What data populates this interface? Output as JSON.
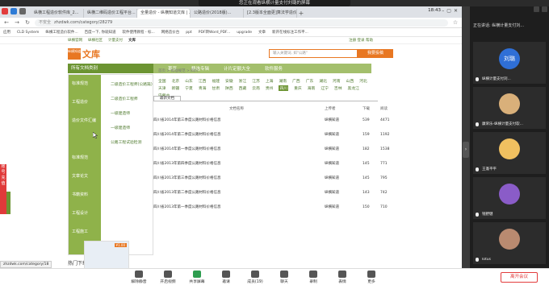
{
  "banner": "您正在观看纵横计量支付刘璐的屏幕",
  "browser": {
    "tabs": [
      "纵横工程造价软件库_2...",
      "纵横二维码造价工程平台...",
      "全量造价 - 纵横知道文库 | ...",
      "公路造价(2018版)...",
      "[2.3版本全面更]算法学造价..."
    ],
    "clock": "18:43",
    "unsafe_label": "不安全",
    "url": "zhzdwk.com/category/28279",
    "bookmarks": [
      "应用",
      "CLD System",
      "纵横工程造价软件...",
      "百度一下, 你就知道",
      "软件使用教程 - 标...",
      "网络造价台",
      "ppt",
      "PDF转Word_PDF...",
      "upgrade",
      "文章",
      "新开在线标注工作平..."
    ]
  },
  "site": {
    "top_links": [
      "纵横官网",
      "纵横社区",
      "计量支付",
      "文库"
    ],
    "login_text": "注册 登录 帮助",
    "logo_badge": "纵横知道",
    "logo_text": "文库",
    "search_placeholder": "输入关键词, 如\"公路\"",
    "search_button": "我要投稿",
    "nav_category": "所有文档类别",
    "nav_items": [
      "首页",
      "精选专辑",
      "计片定额大全",
      "软件服务"
    ],
    "breadcrumb": "首页 > 标准规范 > 四川"
  },
  "sidemenu": {
    "categories": [
      "标准规范",
      "工程造价",
      "造价文件汇编",
      "",
      "标准规范",
      "文章论文",
      "书籍资料",
      "工程设计",
      "工程施工"
    ],
    "submenu": [
      "二级造价工程师(公路篇)",
      "二级造价工程师",
      "一级建造师",
      "一级建造师",
      "公路工程试验检测"
    ]
  },
  "regions": [
    "全国",
    "北京",
    "山东",
    "江西",
    "福建",
    "安徽",
    "浙江",
    "江苏",
    "上海",
    "湖南",
    "广西",
    "广东",
    "湖北",
    "河南",
    "山西",
    "河北",
    "天津",
    "新疆",
    "宁夏",
    "青海",
    "甘肃",
    "陕西",
    "西藏",
    "云南",
    "贵州",
    "四川",
    "重庆",
    "海南",
    "辽宁",
    "吉林",
    "黑龙江",
    "内蒙古"
  ],
  "doc_tab": "最新文档",
  "table": {
    "headers": [
      "文档名称",
      "上传者",
      "下载",
      "阅读"
    ],
    "rows": [
      {
        "title": "四川省2014年第三季度公路材料价格信息",
        "uploader": "纵横知道",
        "downloads": "539",
        "views": "4471"
      },
      {
        "title": "四川省2014年第二季度公路材料价格信息",
        "uploader": "纵横知道",
        "downloads": "159",
        "views": "1192"
      },
      {
        "title": "四川省2014年第一季度公路材料价格信息",
        "uploader": "纵横知道",
        "downloads": "182",
        "views": "1538"
      },
      {
        "title": "四川省2013年第四季度公路材料价格信息",
        "uploader": "纵横知道",
        "downloads": "145",
        "views": "771"
      },
      {
        "title": "四川省2013年第三季度公路材料价格信息",
        "uploader": "纵横知道",
        "downloads": "145",
        "views": "795"
      },
      {
        "title": "四川省2013年第二季度公路材料价格信息",
        "uploader": "纵横知道",
        "downloads": "143",
        "views": "742"
      },
      {
        "title": "四川省2013年第一季度公路材料价格信息",
        "uploader": "纵横知道",
        "downloads": "150",
        "views": "710"
      }
    ]
  },
  "hot_title": "热门下载",
  "hot_tag": "¥1.00",
  "left_float": "账号充值",
  "status_url": "zhzdwk.com/category/18",
  "meeting": {
    "speaking": "正在讲话: 纵横计量支付刘...",
    "participants": [
      {
        "name": "纵横计量支付刘...",
        "avatar_text": "刘璐",
        "color": "#2f6fd6"
      },
      {
        "name": "康荣乐-纵横计量支付软...",
        "avatar_text": "",
        "color": "#d9b07a"
      },
      {
        "name": "王蓬平平",
        "avatar_text": "",
        "color": "#f0c060"
      },
      {
        "name": "钱野健",
        "avatar_text": "",
        "color": "#8a5cc8"
      },
      {
        "name": "lotus",
        "avatar_text": "",
        "color": "#b98a70"
      }
    ],
    "toolbar": [
      "解除静音",
      "开启视频",
      "共享屏幕",
      "邀请",
      "成员(19)",
      "聊天",
      "录制",
      "表情",
      "更多"
    ],
    "end_button": "离开会议"
  }
}
